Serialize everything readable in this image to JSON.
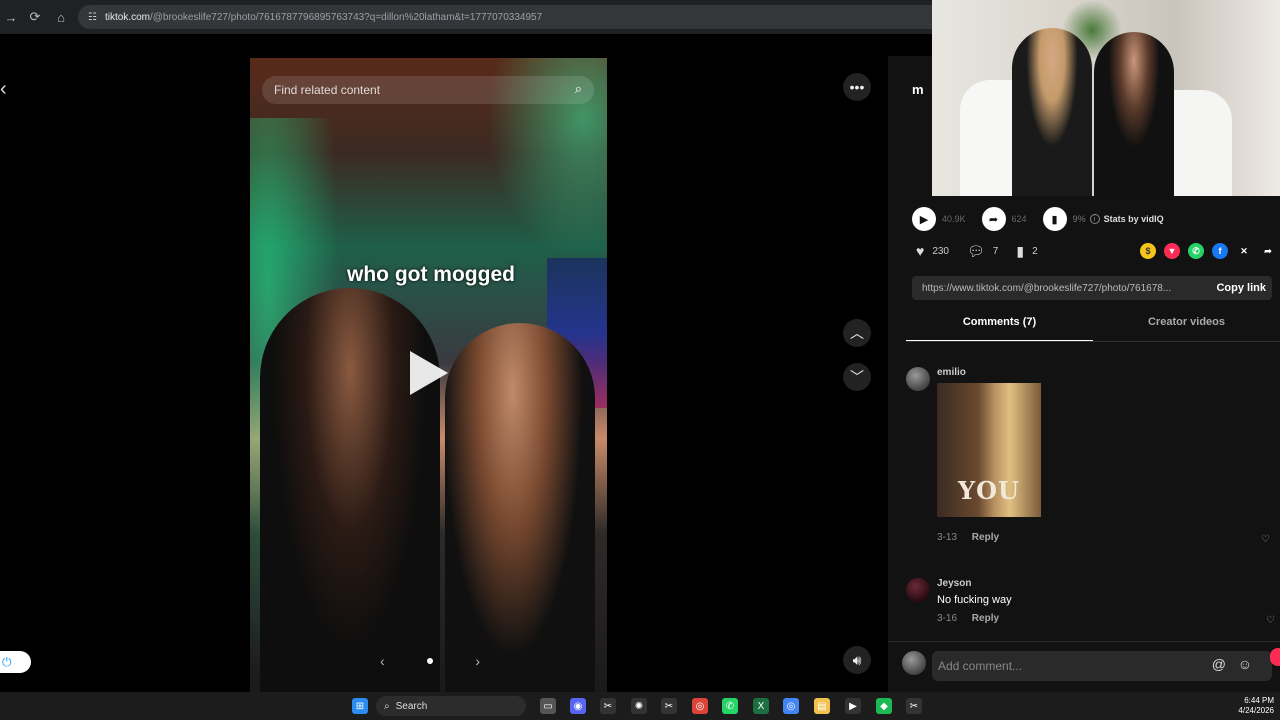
{
  "browser": {
    "url_host": "tiktok.com",
    "url_path": "/@brookeslife727/photo/7616787796895763743?q=dillon%20latham&t=1777070334957"
  },
  "photo": {
    "search_placeholder": "Find related content",
    "overlay_text": "who got mogged"
  },
  "post": {
    "author_initial": "m",
    "stats": {
      "views": "40.9K",
      "shares": "624",
      "engagement": "9%",
      "stats_by": "Stats by vidIQ"
    },
    "likes": "230",
    "comments": "7",
    "saves": "2",
    "link": "https://www.tiktok.com/@brookeslife727/photo/761678...",
    "copy_label": "Copy link"
  },
  "tabs": {
    "comments": "Comments (7)",
    "creator_videos": "Creator videos"
  },
  "comments": [
    {
      "user": "emilio",
      "image_text": "YOU",
      "date": "3-13",
      "reply": "Reply"
    },
    {
      "user": "Jeyson",
      "text": "No fucking way",
      "date": "3-16",
      "reply": "Reply"
    }
  ],
  "composer": {
    "placeholder": "Add comment..."
  },
  "taskbar": {
    "search": "Search",
    "time": "6:44 PM",
    "date": "4/24/2026"
  },
  "colors": {
    "accent": "#fe2c55",
    "panel": "#121212"
  }
}
